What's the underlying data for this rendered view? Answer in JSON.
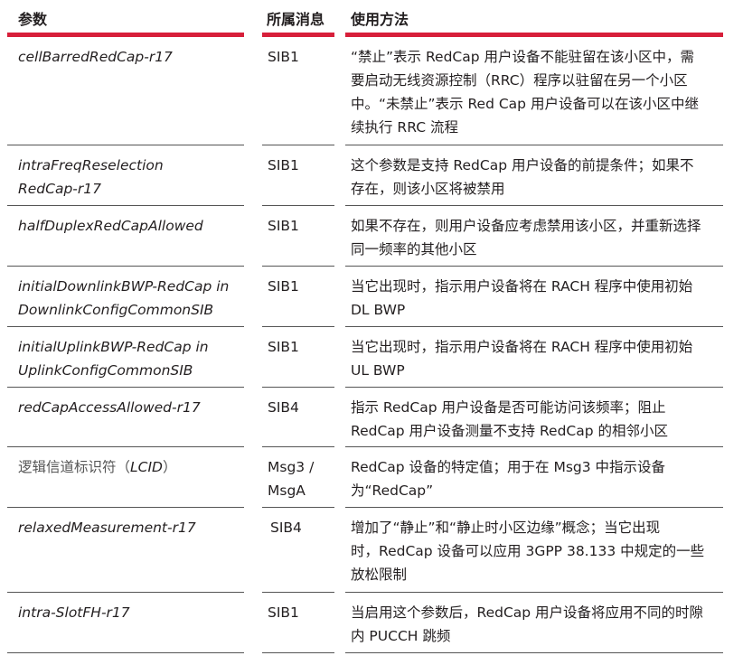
{
  "header": {
    "col_param": "参数",
    "col_msg": "所属消息",
    "col_usage": "使用方法"
  },
  "rows": [
    {
      "param": "cellBarredRedCap-r17",
      "msg": "SIB1",
      "usage_lines": [
        "“禁止”表示 RedCap 用户设备不能驻留在该小区中，需",
        "要启动无线资源控制（RRC）程序以驻留在另一个小区",
        "中。“未禁止”表示 Red Cap 用户设备可以在该小区中继",
        "续执行 RRC 流程"
      ]
    },
    {
      "param_lines": [
        "intraFreqReselection",
        "RedCap-r17"
      ],
      "msg": "SIB1",
      "usage_lines": [
        "这个参数是支持 RedCap 用户设备的前提条件；如果不",
        "存在，则该小区将被禁用"
      ]
    },
    {
      "param": "halfDuplexRedCapAllowed",
      "msg": "SIB1",
      "usage_lines": [
        "如果不存在，则用户设备应考虑禁用该小区，并重新选择",
        "同一频率的其他小区"
      ]
    },
    {
      "param_lines": [
        "initialDownlinkBWP-RedCap in",
        "DownlinkConfigCommonSIB"
      ],
      "msg": "SIB1",
      "usage_lines": [
        "当它出现时，指示用户设备将在 RACH 程序中使用初始",
        "DL BWP"
      ]
    },
    {
      "param_lines": [
        "initialUplinkBWP-RedCap in",
        "UplinkConfigCommonSIB"
      ],
      "msg": "SIB1",
      "usage_lines": [
        "当它出现时，指示用户设备将在 RACH 程序中使用初始",
        "UL BWP"
      ]
    },
    {
      "param": "redCapAccessAllowed-r17",
      "msg": "SIB4",
      "usage_lines": [
        "指示 RedCap 用户设备是否可能访问该频率；阻止",
        "RedCap 用户设备测量不支持 RedCap 的相邻小区"
      ]
    },
    {
      "param_prefix": "逻辑信道标识符（",
      "param_italic": "LCID",
      "param_suffix": "）",
      "msg_lines": [
        "Msg3 /",
        "MsgA"
      ],
      "usage_lines": [
        "RedCap 设备的特定值；用于在 Msg3 中指示设备",
        "为“RedCap”"
      ]
    },
    {
      "param": "relaxedMeasurement-r17",
      "msg": "SIB4",
      "usage_lines": [
        "增加了“静止”和“静止时小区边缘”概念；当它出现",
        "时，RedCap 设备可以应用 3GPP 38.133 中规定的一些",
        "放松限制"
      ]
    },
    {
      "param": "intra-SlotFH-r17",
      "msg": "SIB1",
      "usage_lines": [
        "当启用这个参数后，RedCap 用户设备将应用不同的时隙",
        "内 PUCCH 跳频"
      ]
    }
  ],
  "colors": {
    "accent": "#d71f3a",
    "rule": "#555555",
    "text": "#231f20"
  }
}
